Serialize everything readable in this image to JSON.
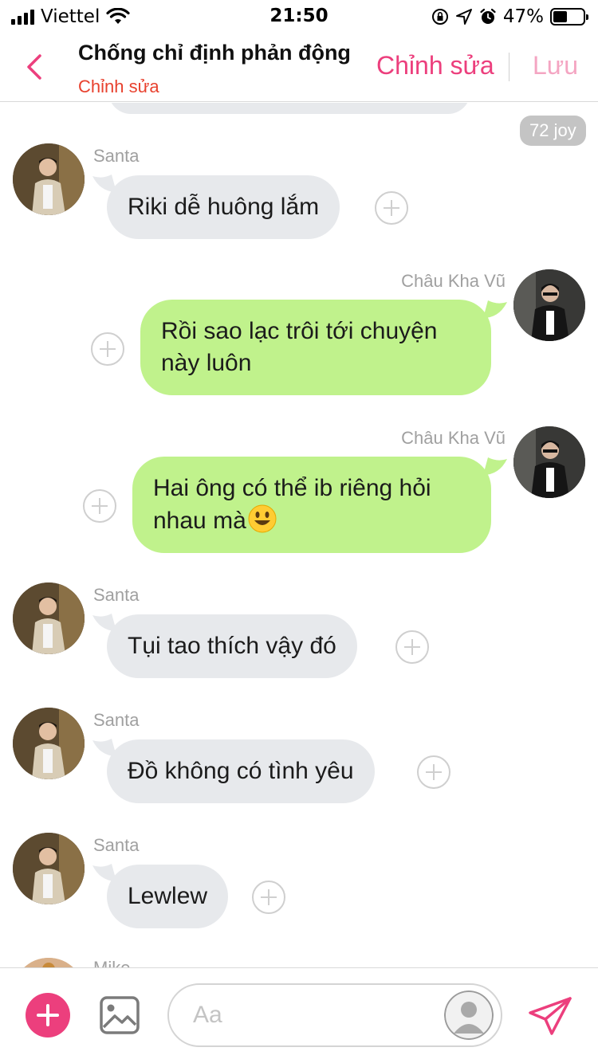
{
  "status_bar": {
    "carrier": "Viettel",
    "time": "21:50",
    "battery_percent": "47%",
    "battery_level": 0.47
  },
  "header": {
    "title": "Chống chỉ định phản động",
    "subtitle": "Chỉnh sửa",
    "edit_label": "Chỉnh sửa",
    "save_label": "Lưu"
  },
  "reaction_badge": "72 joy",
  "messages": [
    {
      "sender": "Santa",
      "side": "in",
      "text": "Riki dễ huông lắm"
    },
    {
      "sender": "Châu Kha Vũ",
      "side": "out",
      "lines": [
        "Rồi sao lạc trôi tới chuyện",
        "này luôn"
      ]
    },
    {
      "sender": "Châu Kha Vũ",
      "side": "out",
      "lines": [
        "Hai ông có thể ib riêng hỏi",
        "nhau mà"
      ],
      "emoji": "smiley-emoji"
    },
    {
      "sender": "Santa",
      "side": "in",
      "text": "Tụi tao thích vậy đó"
    },
    {
      "sender": "Santa",
      "side": "in",
      "text": "Đồ không có tình yêu"
    },
    {
      "sender": "Santa",
      "side": "in",
      "text": "Lewlew"
    }
  ],
  "partial_sender": "Mike",
  "composer": {
    "placeholder": "Aa"
  },
  "colors": {
    "accent": "#ec3f7d",
    "accent_light": "#f4a5c2",
    "subtitle_red": "#e8412e",
    "incoming_bubble": "#e7e9ec",
    "outgoing_bubble": "#c0f28c"
  },
  "icons": [
    "back-chevron-icon",
    "plus-circle-icon",
    "image-icon",
    "send-icon",
    "anonymous-avatar-icon",
    "wifi-icon",
    "lock-rotation-icon",
    "location-icon",
    "alarm-icon",
    "battery-icon"
  ]
}
